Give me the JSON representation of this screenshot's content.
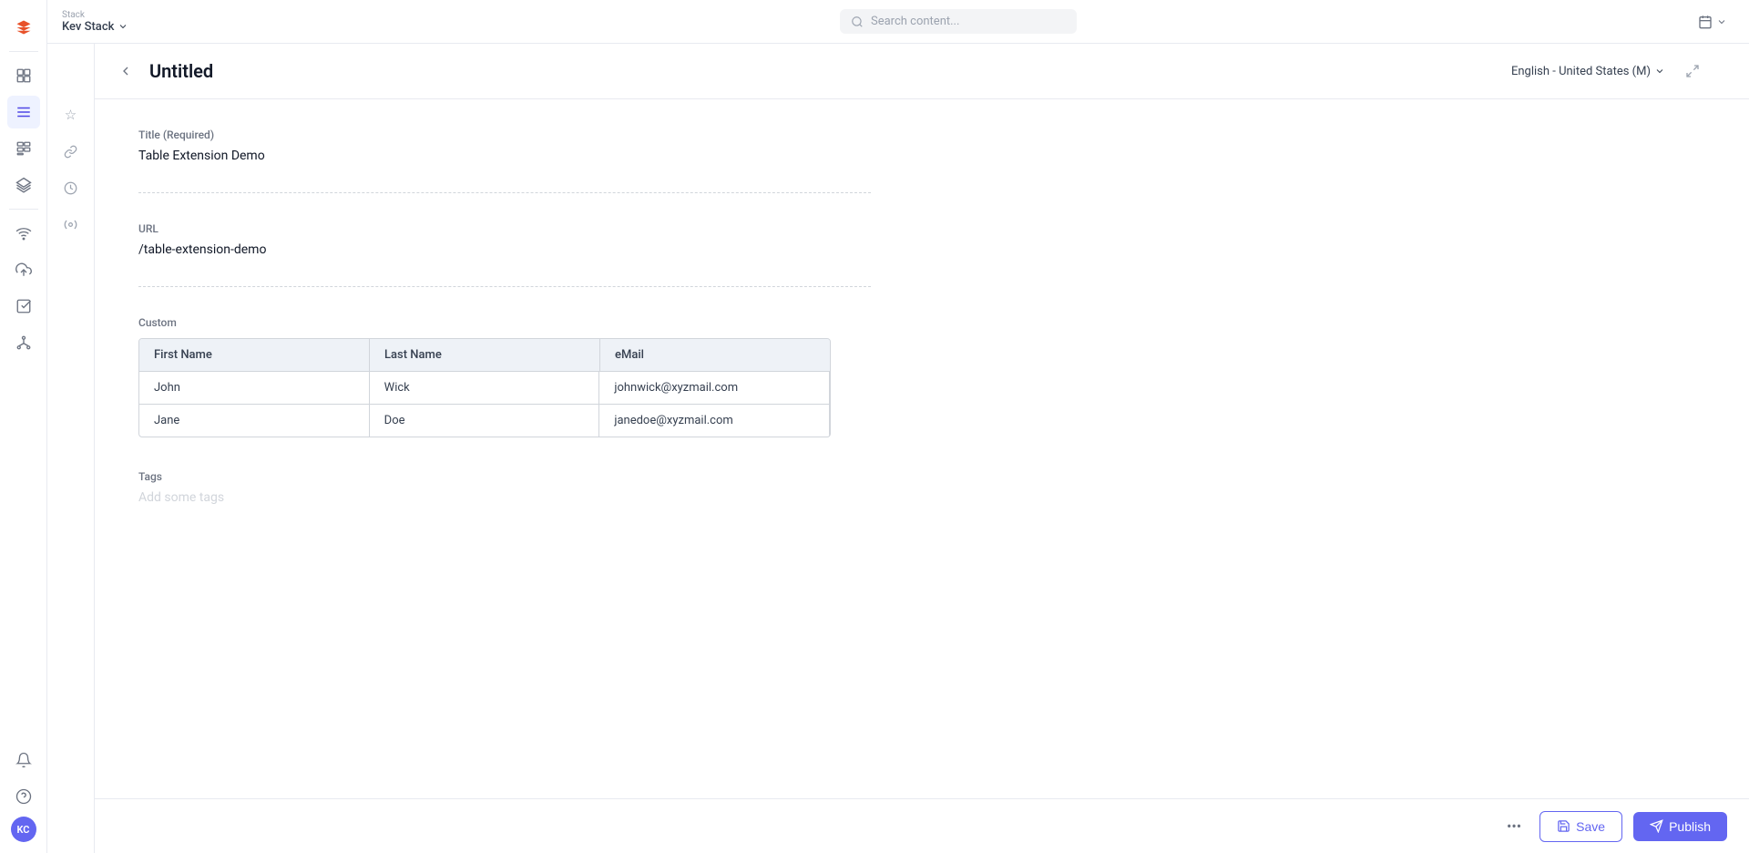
{
  "app": {
    "brand_stack": "Stack",
    "brand_name": "Kev Stack",
    "search_placeholder": "Search content..."
  },
  "topbar": {
    "locale": "English - United States (M)"
  },
  "sidebar": {
    "items": [
      {
        "name": "dashboard",
        "icon": "⊞"
      },
      {
        "name": "list",
        "icon": "≡"
      },
      {
        "name": "components",
        "icon": "⊟"
      },
      {
        "name": "layers",
        "icon": "◫"
      }
    ]
  },
  "secondary_sidebar": {
    "items": [
      {
        "name": "star",
        "icon": "☆"
      },
      {
        "name": "link",
        "icon": "🔗"
      },
      {
        "name": "clock",
        "icon": "○"
      },
      {
        "name": "settings2",
        "icon": "⊕"
      }
    ]
  },
  "page": {
    "title": "Untitled",
    "fields": {
      "title_label": "Title (Required)",
      "title_value": "Table Extension Demo",
      "url_label": "URL",
      "url_value": "/table-extension-demo",
      "custom_label": "Custom",
      "tags_label": "Tags",
      "tags_placeholder": "Add some tags"
    }
  },
  "table": {
    "columns": [
      "First Name",
      "Last Name",
      "eMail"
    ],
    "rows": [
      {
        "first": "John",
        "last": "Wick",
        "email": "johnwick@xyzmail.com"
      },
      {
        "first": "Jane",
        "last": "Doe",
        "email": "janedoe@xyzmail.com"
      }
    ]
  },
  "bottom_bar": {
    "more_dots": "•••",
    "save_label": "Save",
    "publish_label": "Publish"
  },
  "avatar": {
    "initials": "KC"
  }
}
